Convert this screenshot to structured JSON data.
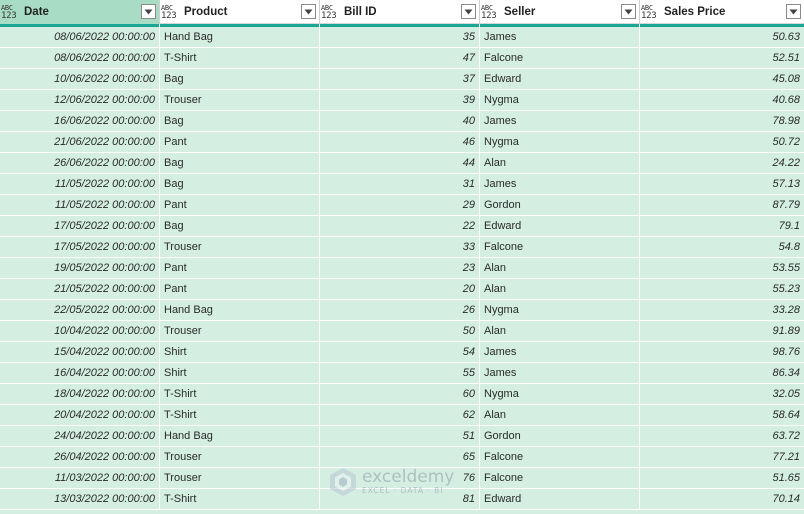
{
  "columns": [
    {
      "type_top": "ABC",
      "type_bottom": "123",
      "label": "Date",
      "selected": true
    },
    {
      "type_top": "ABC",
      "type_bottom": "123",
      "label": "Product",
      "selected": false
    },
    {
      "type_top": "ABC",
      "type_bottom": "123",
      "label": "Bill ID",
      "selected": false
    },
    {
      "type_top": "ABC",
      "type_bottom": "123",
      "label": "Seller",
      "selected": false
    },
    {
      "type_top": "ABC",
      "type_bottom": "123",
      "label": "Sales Price",
      "selected": false
    }
  ],
  "rows": [
    [
      "08/06/2022 00:00:00",
      "Hand Bag",
      "35",
      "James",
      "50.63"
    ],
    [
      "08/06/2022 00:00:00",
      "T-Shirt",
      "47",
      "Falcone",
      "52.51"
    ],
    [
      "10/06/2022 00:00:00",
      "Bag",
      "37",
      "Edward",
      "45.08"
    ],
    [
      "12/06/2022 00:00:00",
      "Trouser",
      "39",
      "Nygma",
      "40.68"
    ],
    [
      "16/06/2022 00:00:00",
      "Bag",
      "40",
      "James",
      "78.98"
    ],
    [
      "21/06/2022 00:00:00",
      "Pant",
      "46",
      "Nygma",
      "50.72"
    ],
    [
      "26/06/2022 00:00:00",
      "Bag",
      "44",
      "Alan",
      "24.22"
    ],
    [
      "11/05/2022 00:00:00",
      "Bag",
      "31",
      "James",
      "57.13"
    ],
    [
      "11/05/2022 00:00:00",
      "Pant",
      "29",
      "Gordon",
      "87.79"
    ],
    [
      "17/05/2022 00:00:00",
      "Bag",
      "22",
      "Edward",
      "79.1"
    ],
    [
      "17/05/2022 00:00:00",
      "Trouser",
      "33",
      "Falcone",
      "54.8"
    ],
    [
      "19/05/2022 00:00:00",
      "Pant",
      "23",
      "Alan",
      "53.55"
    ],
    [
      "21/05/2022 00:00:00",
      "Pant",
      "20",
      "Alan",
      "55.23"
    ],
    [
      "22/05/2022 00:00:00",
      "Hand Bag",
      "26",
      "Nygma",
      "33.28"
    ],
    [
      "10/04/2022 00:00:00",
      "Trouser",
      "50",
      "Alan",
      "91.89"
    ],
    [
      "15/04/2022 00:00:00",
      "Shirt",
      "54",
      "James",
      "98.76"
    ],
    [
      "16/04/2022 00:00:00",
      "Shirt",
      "55",
      "James",
      "86.34"
    ],
    [
      "18/04/2022 00:00:00",
      "T-Shirt",
      "60",
      "Nygma",
      "32.05"
    ],
    [
      "20/04/2022 00:00:00",
      "T-Shirt",
      "62",
      "Alan",
      "58.64"
    ],
    [
      "24/04/2022 00:00:00",
      "Hand Bag",
      "51",
      "Gordon",
      "63.72"
    ],
    [
      "26/04/2022 00:00:00",
      "Trouser",
      "65",
      "Falcone",
      "77.21"
    ],
    [
      "11/03/2022 00:00:00",
      "Trouser",
      "76",
      "Falcone",
      "51.65"
    ],
    [
      "13/03/2022 00:00:00",
      "T-Shirt",
      "81",
      "Edward",
      "70.14"
    ]
  ],
  "column_alignment": [
    "num",
    "txt",
    "num",
    "txt",
    "num"
  ],
  "watermark": {
    "name": "exceldemy",
    "tagline": "EXCEL · DATA · BI"
  },
  "colors": {
    "selected_header": "#a9dcc4",
    "quality_bar": "#19a894",
    "cell_background": "#d4efe2"
  },
  "icons": {
    "column_type": "abc-123-type-icon",
    "filter": "chevron-down-icon"
  }
}
